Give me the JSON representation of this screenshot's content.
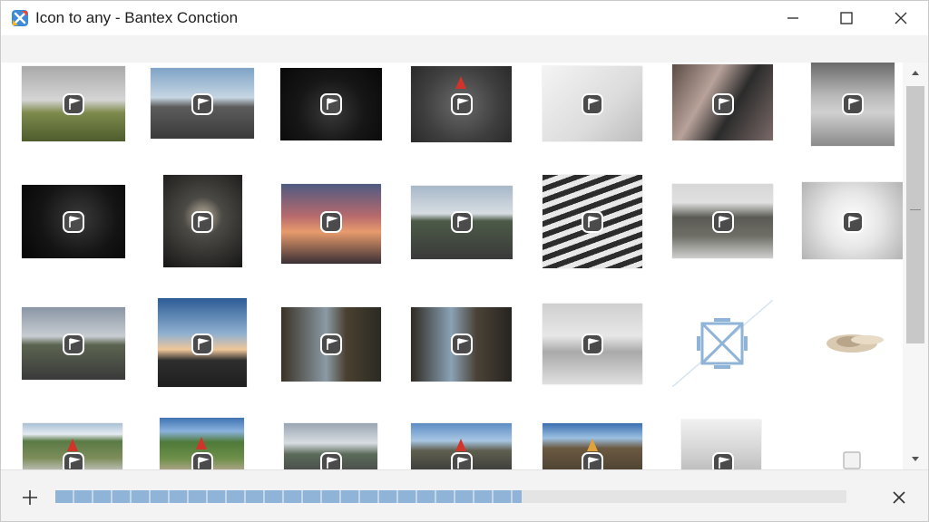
{
  "window": {
    "title": "Icon to any - Bantex Conction",
    "minimize_icon": "minimize-icon",
    "maximize_icon": "maximize-icon",
    "close_icon": "close-icon"
  },
  "colors": {
    "accent": "#8fb4d7",
    "toolbar_bg": "#f3f3f3",
    "scroll_thumb": "#c8c8c8"
  },
  "gallery": {
    "overlay_icon": "flag-badge-icon",
    "placeholder_icon": "broken-image-icon",
    "rows": [
      [
        "cloudy-field",
        "road-horizon",
        "dark-road",
        "cyclist-hat",
        "white-wall",
        "people-crowd",
        "portrait-road"
      ],
      [
        "night-lights",
        "tunnel-lights",
        "sunset-figure",
        "road-trees",
        "striped-wall",
        "beach-field",
        "light-burst"
      ],
      [
        "road-straight",
        "sky-rays",
        "street-bldgs",
        "street-bldgs-2",
        "misty-road",
        "placeholder",
        "pastry"
      ],
      [
        "green-valley",
        "field-path",
        "cloudy-road",
        "blue-sky-road",
        "mountain-sky",
        "white-fog",
        "blank-icon"
      ]
    ]
  },
  "bottombar": {
    "add_icon": "plus-icon",
    "progress": 0.59,
    "cancel_icon": "close-icon"
  },
  "scrollbar": {
    "position": 0.0
  }
}
